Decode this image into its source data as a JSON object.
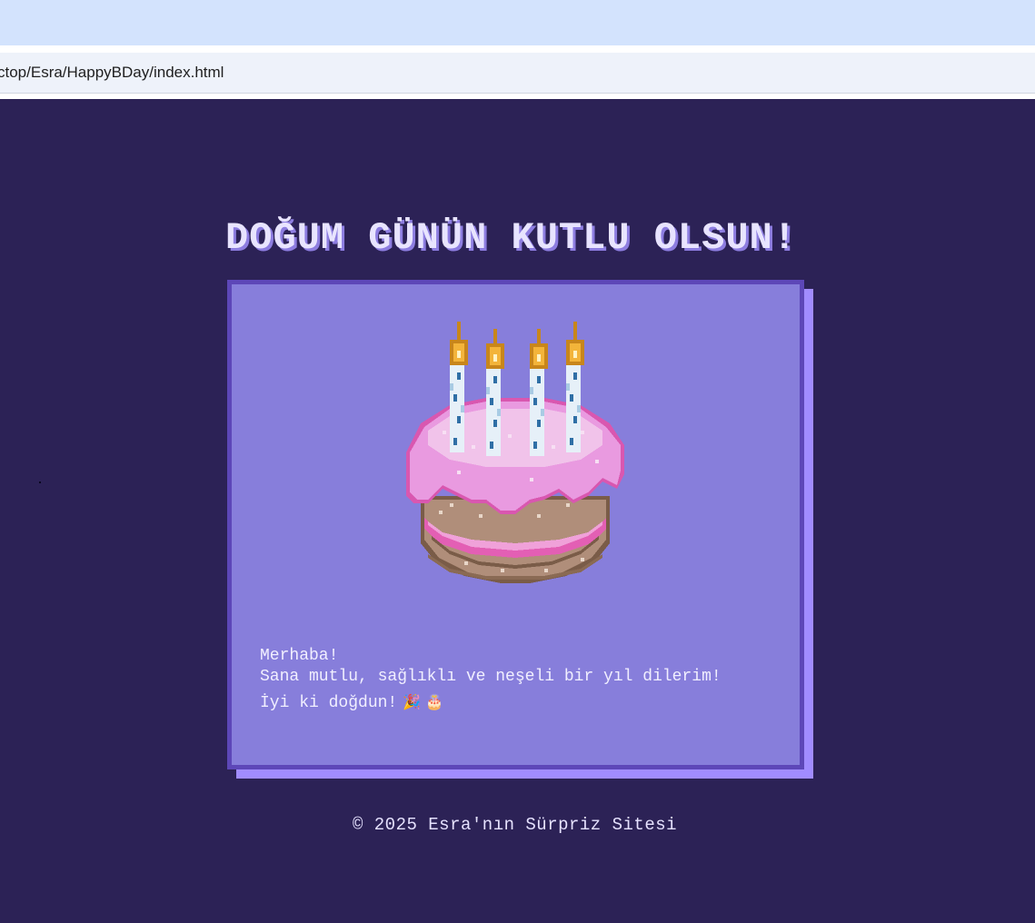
{
  "browser": {
    "url": "ctop/Esra/HappyBDay/index.html"
  },
  "page": {
    "title": "DOĞUM GÜNÜN KUTLU OLSUN!",
    "message": {
      "line1": "Merhaba!",
      "line2": "Sana mutlu, sağlıklı ve neşeli bir yıl dilerim!",
      "line3": "İyi ki doğdun!",
      "emoji": "🎉 🎂"
    },
    "footer": "© 2025 Esra'nın Sürpriz Sitesi"
  },
  "colors": {
    "background": "#2c2256",
    "card": "#877edb",
    "card_border": "#5d47b8",
    "card_shadow": "#a18cff",
    "title": "#e8e4ff",
    "title_shadow": "#8d7de0",
    "frosting": "#e99ae0",
    "cake_body": "#b08e7a"
  },
  "icons": {
    "cake": "pixel-birthday-cake",
    "candle_count": 4
  }
}
